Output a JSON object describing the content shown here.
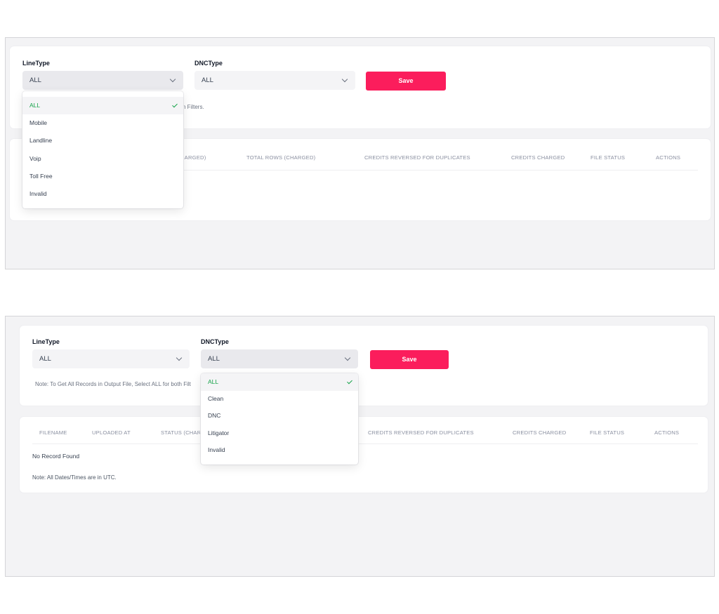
{
  "panel1": {
    "linetype_label": "LineType",
    "dnctype_label": "DNCType",
    "linetype_value": "ALL",
    "dnctype_value": "ALL",
    "save_label": "Save",
    "note_fragment": "h Filters.",
    "headers": [
      "HARGED)",
      "TOTAL ROWS (CHARGED)",
      "CREDITS REVERSED FOR DUPLICATES",
      "CREDITS CHARGED",
      "FILE STATUS",
      "ACTIONS"
    ],
    "linetype_options": [
      "ALL",
      "Mobile",
      "Landline",
      "Voip",
      "Toll Free",
      "Invalid"
    ],
    "selected_option": "ALL"
  },
  "panel2": {
    "linetype_label": "LineType",
    "dnctype_label": "DNCType",
    "linetype_value": "ALL",
    "dnctype_value": "ALL",
    "save_label": "Save",
    "note": "Note: To Get All Records in Output File, Select ALL for both Filt",
    "headers": [
      "FILENAME",
      "UPLOADED AT",
      "STATUS (CHAR",
      "CREDITS REVERSED FOR DUPLICATES",
      "CREDITS CHARGED",
      "FILE STATUS",
      "ACTIONS"
    ],
    "no_record": "No Record Found",
    "footer_note": "Note: All Dates/Times are in UTC.",
    "dnctype_options": [
      "ALL",
      "Clean",
      "DNC",
      "Litigator",
      "Invalid"
    ],
    "selected_option": "ALL"
  },
  "colors": {
    "accent": "#fb1d5c",
    "selected": "#16a34a"
  },
  "icons": {
    "dropdown": "chevron-down-icon",
    "selected": "checkmark-icon"
  }
}
